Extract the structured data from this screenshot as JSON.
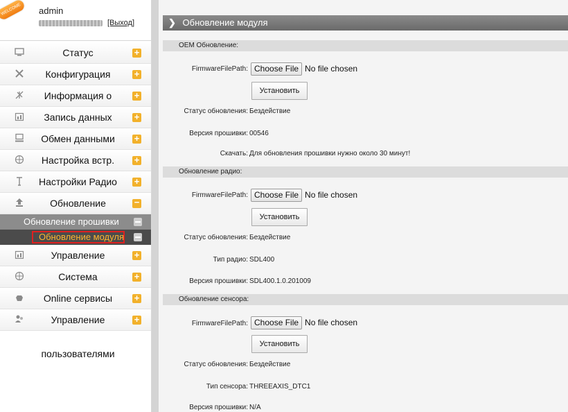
{
  "user": {
    "badge_text": "WELCOME",
    "name": "admin",
    "logout_label": "[Выход]"
  },
  "menu": [
    {
      "label": "Статус",
      "icon": "monitor-icon",
      "name": "menu-status"
    },
    {
      "label": "Конфигурация",
      "icon": "tools-icon",
      "name": "menu-config"
    },
    {
      "label": "Информация о",
      "icon": "signal-icon",
      "name": "menu-info"
    },
    {
      "label": "Запись данных",
      "icon": "calendar-icon",
      "name": "menu-data-log"
    },
    {
      "label": "Обмен данными",
      "icon": "computer-icon",
      "name": "menu-data-exchange"
    },
    {
      "label": "Настройка встр.",
      "icon": "globe-icon",
      "name": "menu-builtin-settings"
    },
    {
      "label": "Настройки Радио",
      "icon": "antenna-icon",
      "name": "menu-radio-settings"
    },
    {
      "label": "Обновление",
      "icon": "upload-icon",
      "name": "menu-update",
      "expanded": true
    },
    {
      "label": "Управление",
      "icon": "calendar-icon",
      "name": "menu-management"
    },
    {
      "label": "Система",
      "icon": "globe-icon",
      "name": "menu-system"
    },
    {
      "label": "Online сервисы",
      "icon": "cloud-icon",
      "name": "menu-online-services"
    },
    {
      "label": "Управление",
      "icon": "users-icon",
      "name": "menu-user-management"
    }
  ],
  "submenu": [
    {
      "label": "Обновление прошивки",
      "active": false
    },
    {
      "label": "Обновление модуля",
      "active": true
    }
  ],
  "menu_continuation": "пользователями",
  "page": {
    "title": "Обновление модуля",
    "file_button": "Choose File",
    "no_file": "No file chosen",
    "install_label": "Установить",
    "sections": [
      {
        "title": "OEM Обновление:",
        "path_label": "FirmwareFilePath:",
        "status_label": "Статус обновления:",
        "status_value": "Бездействие",
        "version_label": "Версия прошивки:",
        "version_value": "00546",
        "download_label": "Скачать:",
        "download_value": "Для обновления прошивки нужно около 30 минут!"
      },
      {
        "title": "Обновление радио:",
        "path_label": "FirmwareFilePath:",
        "status_label": "Статус обновления:",
        "status_value": "Бездействие",
        "type_label": "Тип радио:",
        "type_value": "SDL400",
        "version_label": "Версия прошивки:",
        "version_value": "SDL400.1.0.201009"
      },
      {
        "title": "Обновление сенсора:",
        "path_label": "FirmwareFilePath:",
        "status_label": "Статус обновления:",
        "status_value": "Бездействие",
        "type_label": "Тип сенсора:",
        "type_value": "THREEAXIS_DTC1",
        "version_label": "Версия прошивки:",
        "version_value": "N/A"
      }
    ]
  }
}
